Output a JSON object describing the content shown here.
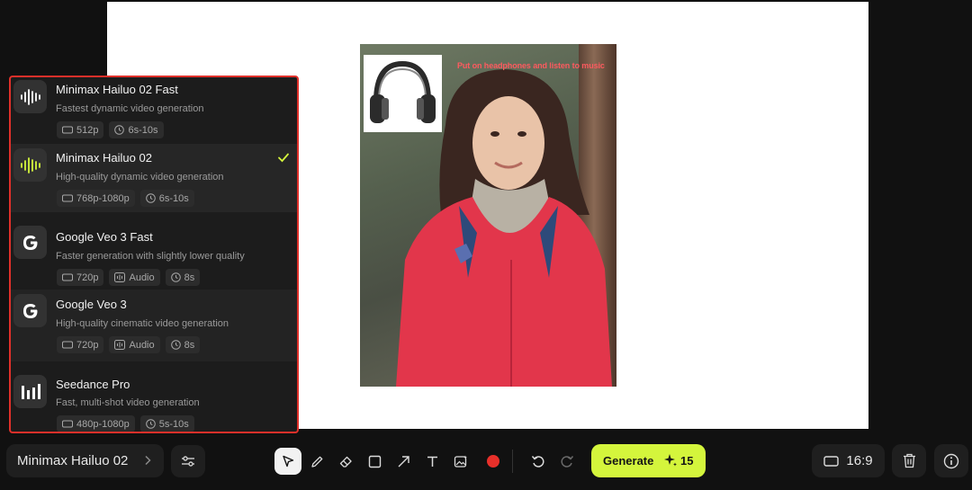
{
  "canvas": {
    "overlay_text": "Put on headphones and listen to music"
  },
  "models": [
    {
      "name": "Minimax Hailuo 02 Fast",
      "description": "Fastest dynamic video generation",
      "icon": "waveform-icon",
      "tags": {
        "resolution": "512p",
        "duration": "6s-10s"
      },
      "selected": false
    },
    {
      "name": "Minimax Hailuo 02",
      "description": "High-quality dynamic video generation",
      "icon": "waveform-icon",
      "tags": {
        "resolution": "768p-1080p",
        "duration": "6s-10s"
      },
      "selected": true
    },
    {
      "name": "Google Veo 3 Fast",
      "description": "Faster generation with slightly lower quality",
      "icon": "google-icon",
      "tags": {
        "resolution": "720p",
        "audio": "Audio",
        "duration": "8s"
      },
      "selected": false
    },
    {
      "name": "Google Veo 3",
      "description": "High-quality cinematic video generation",
      "icon": "google-icon",
      "tags": {
        "resolution": "720p",
        "audio": "Audio",
        "duration": "8s"
      },
      "selected": false
    },
    {
      "name": "Seedance Pro",
      "description": "Fast, multi-shot video generation",
      "icon": "bars-icon",
      "tags": {
        "resolution": "480p-1080p",
        "duration": "5s-10s"
      },
      "selected": false
    }
  ],
  "bottom_bar": {
    "model_selector_label": "Minimax Hailuo 02",
    "generate_label": "Generate",
    "credits": "15",
    "aspect_ratio": "16:9"
  },
  "colors": {
    "accent": "#d4f53c",
    "highlight_border": "#e0302a",
    "color_swatch": "#e8302a"
  }
}
